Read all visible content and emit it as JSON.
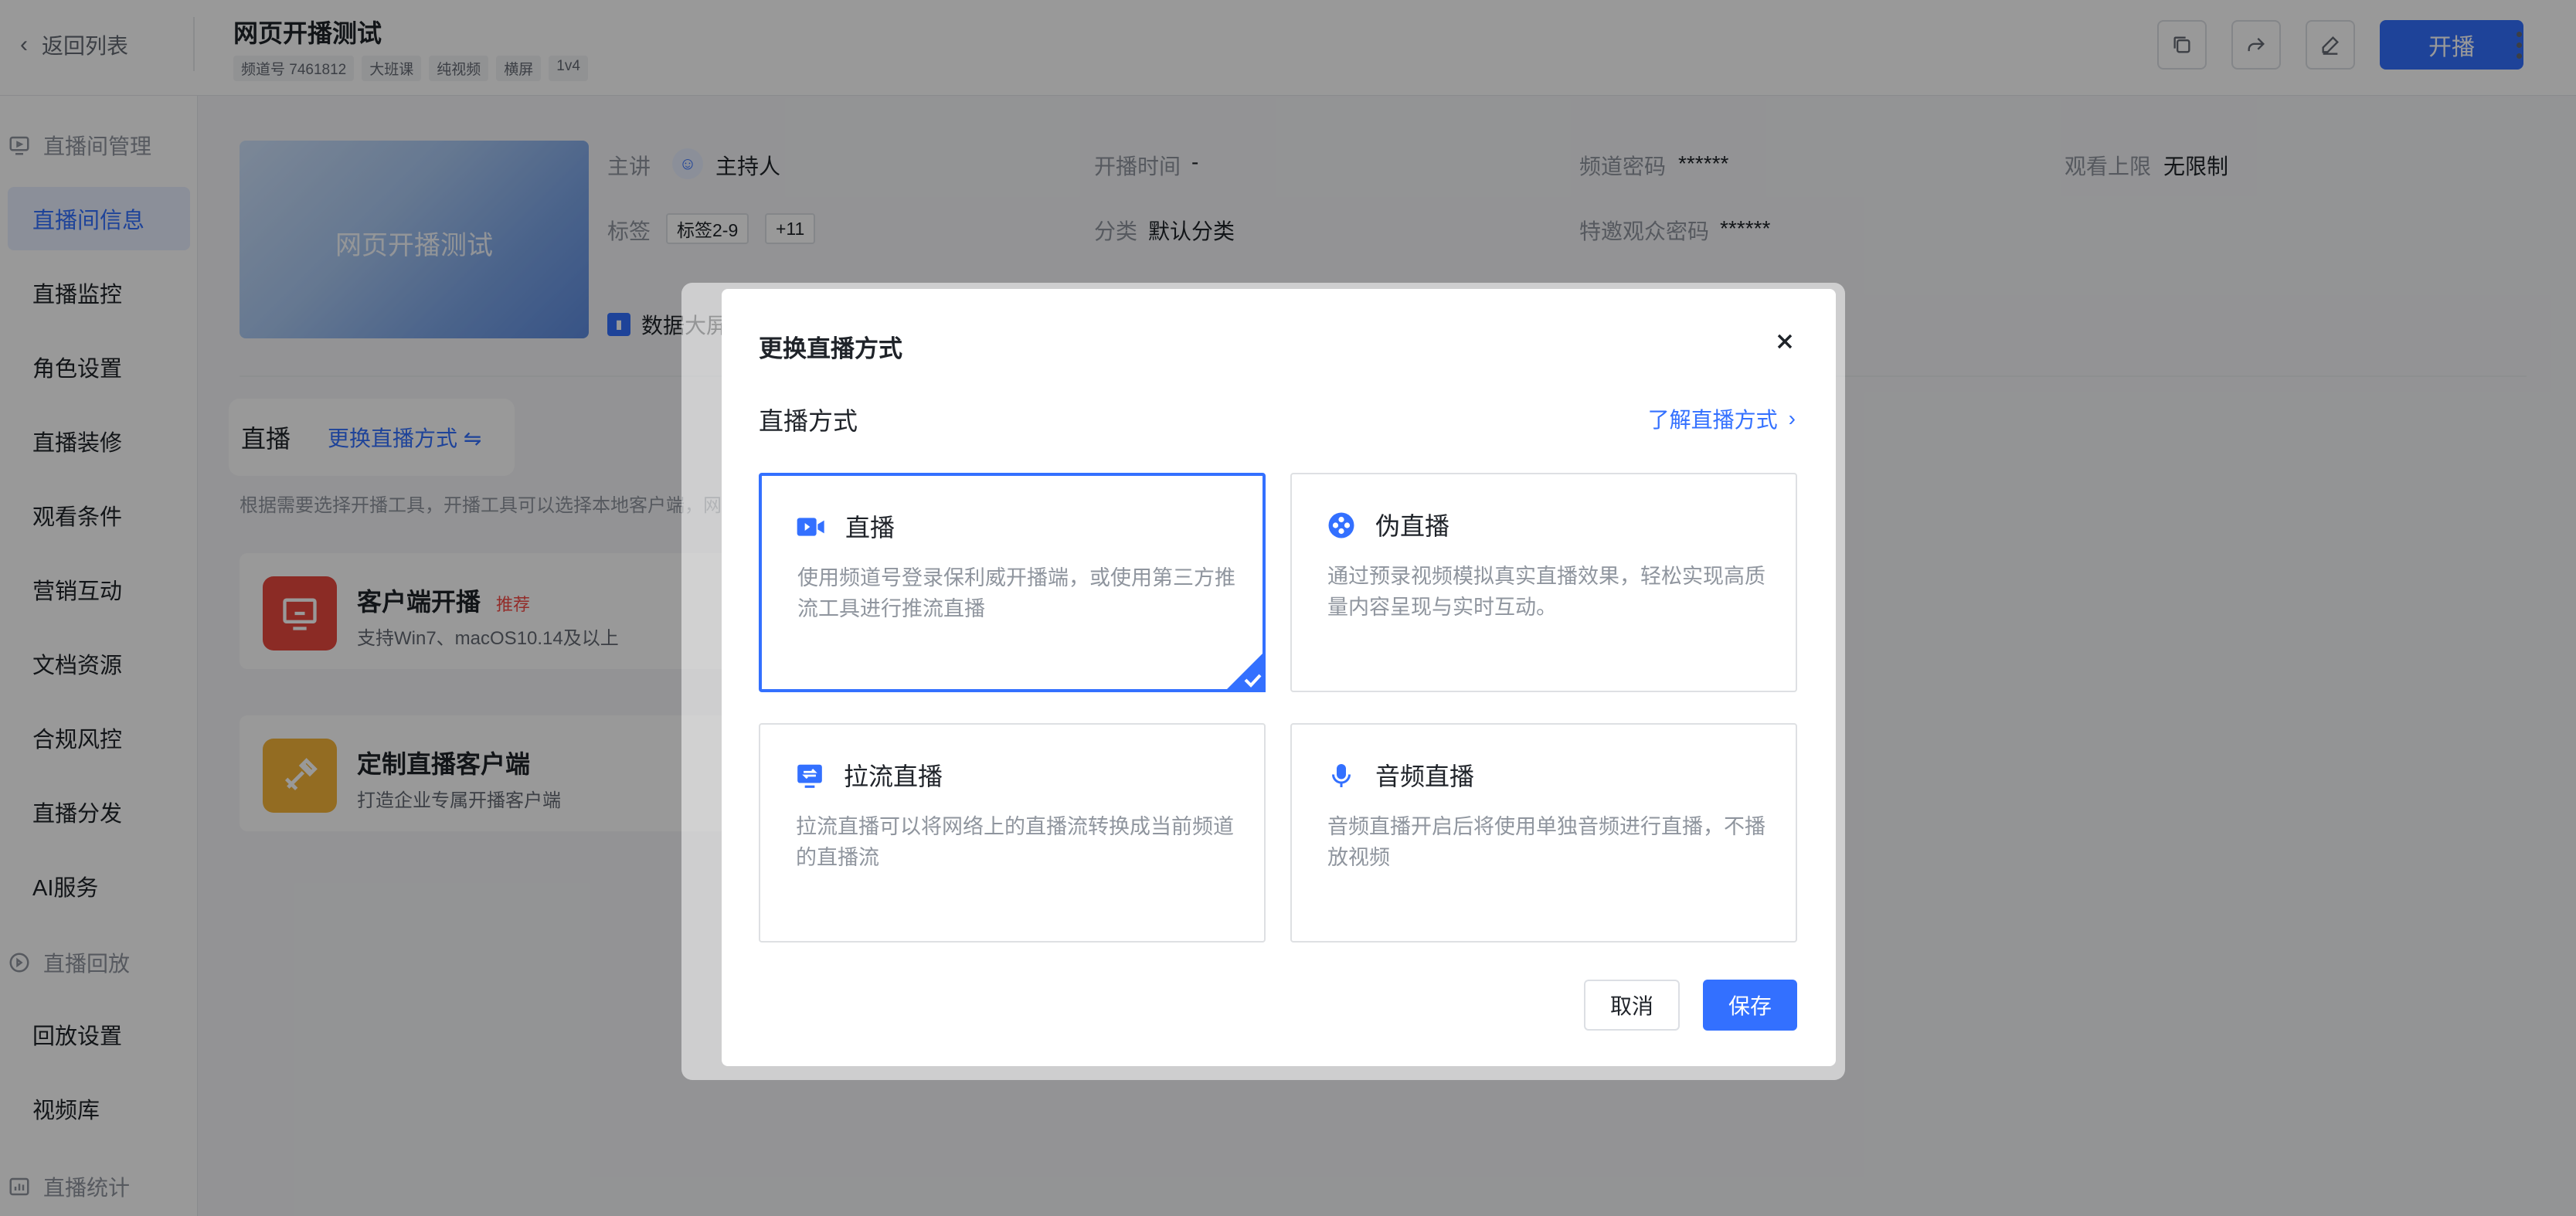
{
  "header": {
    "back_label": "返回列表",
    "title": "网页开播测试",
    "meta_tags": [
      "频道号 7461812",
      "大班课",
      "纯视频",
      "横屏",
      "1v4"
    ],
    "start_label": "开播"
  },
  "sidebar": {
    "groups": [
      {
        "label": "直播间管理"
      },
      {
        "label": "直播回放"
      },
      {
        "label": "直播统计"
      }
    ],
    "items": [
      {
        "label": "直播间信息"
      },
      {
        "label": "直播监控"
      },
      {
        "label": "角色设置"
      },
      {
        "label": "直播装修"
      },
      {
        "label": "观看条件"
      },
      {
        "label": "营销互动"
      },
      {
        "label": "文档资源"
      },
      {
        "label": "合规风控"
      },
      {
        "label": "直播分发"
      },
      {
        "label": "AI服务"
      },
      {
        "label": "回放设置"
      },
      {
        "label": "视频库"
      }
    ]
  },
  "info": {
    "thumbnail_title": "网页开播测试",
    "host_label": "主讲",
    "host_name": "主持人",
    "tags_label": "标签",
    "tag_value": "标签2-9",
    "tag_more": "+11",
    "start_time_label": "开播时间",
    "start_time_value": "-",
    "category_label": "分类",
    "category_value": "默认分类",
    "channel_pwd_label": "频道密码",
    "channel_pwd_value": "******",
    "guest_pwd_label": "特邀观众密码",
    "guest_pwd_value": "******",
    "view_limit_label": "观看上限",
    "view_limit_value": "无限制",
    "dashboard_label": "数据大屏"
  },
  "live_section": {
    "label": "直播",
    "switch_label": "更换直播方式 ⇋",
    "hint": "根据需要选择开播工具，开播工具可以选择本地客户端，网"
  },
  "methods": [
    {
      "title": "客户端开播",
      "badge": "推荐",
      "desc": "支持Win7、macOS10.14及以上"
    },
    {
      "title": "定制直播客户端",
      "badge": "",
      "desc": "打造企业专属开播客户端"
    }
  ],
  "modal": {
    "title": "更换直播方式",
    "subtitle": "直播方式",
    "learn_link": "了解直播方式",
    "options": [
      {
        "title": "直播",
        "desc": "使用频道号登录保利威开播端，或使用第三方推流工具进行推流直播",
        "selected": true
      },
      {
        "title": "伪直播",
        "desc": "通过预录视频模拟真实直播效果，轻松实现高质量内容呈现与实时互动。",
        "selected": false
      },
      {
        "title": "拉流直播",
        "desc": "拉流直播可以将网络上的直播流转换成当前频道的直播流",
        "selected": false
      },
      {
        "title": "音频直播",
        "desc": "音频直播开启后将使用单独音频进行直播，不播放视频",
        "selected": false
      }
    ],
    "cancel_label": "取消",
    "save_label": "保存"
  },
  "colors": {
    "accent": "#3370ff",
    "danger": "#f54a45",
    "client_icon_bg": "#e8483f",
    "custom_icon_bg": "#f5b53a"
  }
}
